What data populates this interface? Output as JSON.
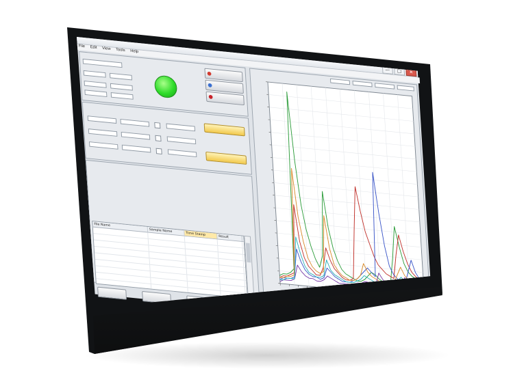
{
  "window": {
    "title": "",
    "buttons": [
      "—",
      "□",
      "✕"
    ]
  },
  "menubar": [
    "File",
    "Edit",
    "View",
    "Tools",
    "Help"
  ],
  "status_panel": {
    "led_label": "",
    "buttons": [
      "",
      "",
      ""
    ]
  },
  "measure_panel": {
    "action_buttons": [
      "",
      ""
    ]
  },
  "table": {
    "columns": [
      "File Name",
      "Sample Name",
      "Time Stamp",
      "Result"
    ],
    "rows": [
      [
        "",
        "",
        "",
        ""
      ],
      [
        "",
        "",
        "",
        ""
      ],
      [
        "",
        "",
        "",
        ""
      ],
      [
        "",
        "",
        "",
        ""
      ],
      [
        "",
        "",
        "",
        ""
      ],
      [
        "",
        "",
        "",
        ""
      ],
      [
        "",
        "",
        "",
        ""
      ],
      [
        "",
        "",
        "",
        ""
      ],
      [
        "",
        "",
        "",
        ""
      ],
      [
        "",
        "",
        "",
        ""
      ]
    ]
  },
  "bottom_buttons": [
    "",
    "",
    "",
    ""
  ],
  "colors": {
    "led": "#2fdc2a",
    "accent_button": "#f2c94c",
    "series": [
      "#2c9c3a",
      "#c0302a",
      "#3a55c8",
      "#d88a2a",
      "#7a3aa8",
      "#2ab0b8"
    ]
  },
  "chart_data": {
    "type": "line",
    "title": "",
    "xlabel": "",
    "ylabel": "",
    "grid": true,
    "x": [
      0,
      1,
      2,
      3,
      4,
      5,
      6,
      7,
      8,
      9,
      10,
      11,
      12,
      13,
      14,
      15,
      16,
      17,
      18,
      19,
      20,
      21,
      22,
      23,
      24,
      25,
      26,
      27,
      28,
      29,
      30,
      31,
      32,
      33,
      34,
      35,
      36,
      37,
      38,
      39
    ],
    "ylim": [
      0,
      100
    ],
    "series": [
      {
        "values": [
          4,
          5,
          5,
          6,
          8,
          96,
          62,
          40,
          28,
          20,
          14,
          10,
          16,
          48,
          30,
          20,
          14,
          10,
          8,
          7,
          6,
          5,
          5,
          6,
          8,
          10,
          9,
          7,
          6,
          6,
          5,
          18,
          34,
          24,
          16,
          12,
          10,
          9,
          8,
          7
        ]
      },
      {
        "values": [
          3,
          4,
          4,
          5,
          6,
          40,
          22,
          14,
          10,
          8,
          6,
          6,
          10,
          20,
          14,
          10,
          8,
          6,
          5,
          5,
          6,
          30,
          52,
          40,
          30,
          24,
          18,
          14,
          12,
          10,
          9,
          8,
          20,
          30,
          22,
          16,
          12,
          10,
          9,
          8
        ]
      },
      {
        "values": [
          2,
          3,
          3,
          3,
          4,
          18,
          12,
          8,
          6,
          5,
          5,
          4,
          5,
          10,
          8,
          6,
          5,
          4,
          4,
          4,
          5,
          6,
          8,
          10,
          12,
          10,
          8,
          60,
          40,
          24,
          14,
          10,
          8,
          7,
          6,
          12,
          18,
          12,
          9,
          8
        ]
      },
      {
        "values": [
          3,
          3,
          4,
          4,
          5,
          58,
          34,
          22,
          14,
          10,
          8,
          7,
          8,
          36,
          20,
          12,
          9,
          7,
          6,
          5,
          5,
          6,
          8,
          14,
          10,
          8,
          7,
          6,
          6,
          5,
          5,
          6,
          10,
          14,
          10,
          8,
          7,
          6,
          6,
          5
        ]
      },
      {
        "values": [
          1,
          2,
          2,
          2,
          3,
          10,
          7,
          5,
          4,
          4,
          3,
          3,
          4,
          6,
          5,
          4,
          3,
          3,
          3,
          3,
          3,
          4,
          4,
          5,
          5,
          4,
          4,
          10,
          7,
          5,
          4,
          4,
          4,
          6,
          9,
          6,
          5,
          4,
          4,
          3
        ]
      },
      {
        "values": [
          2,
          2,
          3,
          3,
          3,
          24,
          16,
          10,
          7,
          6,
          5,
          5,
          6,
          14,
          9,
          7,
          6,
          5,
          4,
          4,
          4,
          5,
          6,
          8,
          7,
          6,
          5,
          5,
          5,
          4,
          4,
          5,
          7,
          9,
          7,
          6,
          5,
          5,
          4,
          4
        ]
      }
    ]
  }
}
